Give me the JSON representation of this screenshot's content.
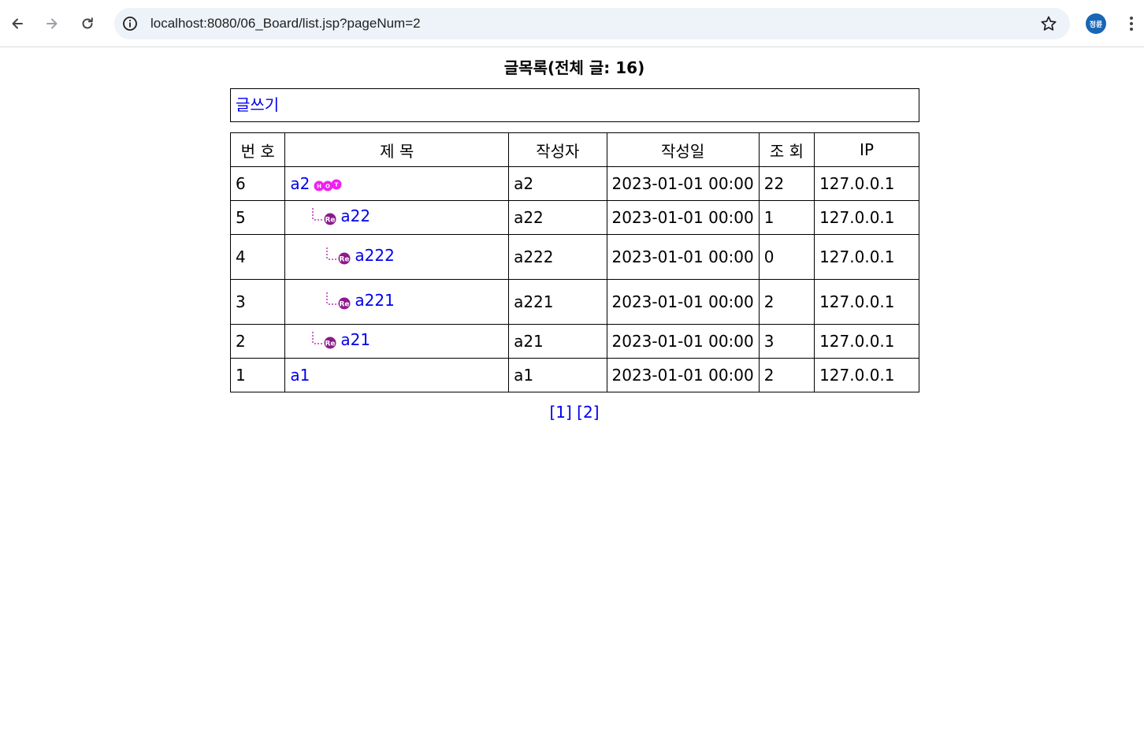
{
  "browser": {
    "url": "localhost:8080/06_Board/list.jsp?pageNum=2",
    "profile_initials": "정륜",
    "accent_color": "#1a66b5"
  },
  "page": {
    "title": "글목록(전체 글: 16)",
    "write_link": "글쓰기"
  },
  "table": {
    "headers": [
      "번 호",
      "제 목",
      "작성자",
      "작성일",
      "조 회",
      "IP"
    ],
    "rows": [
      {
        "num": "6",
        "title": "a2",
        "depth": 0,
        "hot": true,
        "writer": "a2",
        "date": "2023-01-01 00:00",
        "views": "22",
        "ip": "127.0.0.1"
      },
      {
        "num": "5",
        "title": "a22",
        "depth": 1,
        "hot": false,
        "writer": "a22",
        "date": "2023-01-01 00:00",
        "views": "1",
        "ip": "127.0.0.1"
      },
      {
        "num": "4",
        "title": "a222",
        "depth": 2,
        "hot": false,
        "writer": "a222",
        "date": "2023-01-01 00:00",
        "views": "0",
        "ip": "127.0.0.1"
      },
      {
        "num": "3",
        "title": "a221",
        "depth": 2,
        "hot": false,
        "writer": "a221",
        "date": "2023-01-01 00:00",
        "views": "2",
        "ip": "127.0.0.1"
      },
      {
        "num": "2",
        "title": "a21",
        "depth": 1,
        "hot": false,
        "writer": "a21",
        "date": "2023-01-01 00:00",
        "views": "3",
        "ip": "127.0.0.1"
      },
      {
        "num": "1",
        "title": "a1",
        "depth": 0,
        "hot": false,
        "writer": "a1",
        "date": "2023-01-01 00:00",
        "views": "2",
        "ip": "127.0.0.1"
      }
    ]
  },
  "pager": {
    "pages": [
      "[1]",
      "[2]"
    ]
  },
  "icons": {
    "reply": "reply-re-icon",
    "hot": "hot-badge-icon"
  }
}
